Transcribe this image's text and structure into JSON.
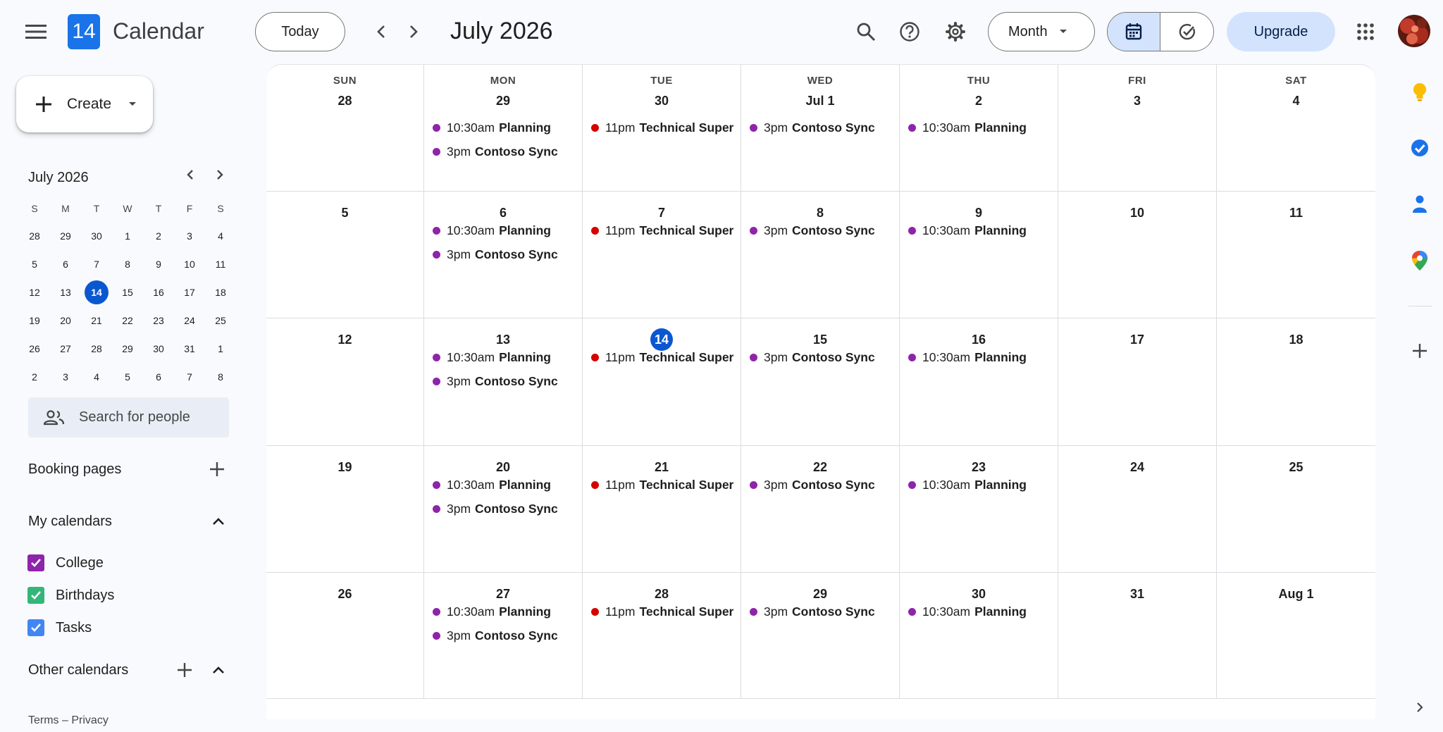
{
  "header": {
    "app_title": "Calendar",
    "logo_date": "14",
    "today_label": "Today",
    "month_title": "July 2026",
    "view_label": "Month",
    "upgrade_label": "Upgrade"
  },
  "sidebar": {
    "create_label": "Create",
    "mini_calendar": {
      "title": "July 2026",
      "weekdays": [
        "S",
        "M",
        "T",
        "W",
        "T",
        "F",
        "S"
      ],
      "weeks": [
        [
          "28",
          "29",
          "30",
          "1",
          "2",
          "3",
          "4"
        ],
        [
          "5",
          "6",
          "7",
          "8",
          "9",
          "10",
          "11"
        ],
        [
          "12",
          "13",
          "14",
          "15",
          "16",
          "17",
          "18"
        ],
        [
          "19",
          "20",
          "21",
          "22",
          "23",
          "24",
          "25"
        ],
        [
          "26",
          "27",
          "28",
          "29",
          "30",
          "31",
          "1"
        ],
        [
          "2",
          "3",
          "4",
          "5",
          "6",
          "7",
          "8"
        ]
      ],
      "today": "14"
    },
    "search_placeholder": "Search for people",
    "booking_pages_label": "Booking pages",
    "my_calendars_label": "My calendars",
    "my_calendars": [
      {
        "label": "College",
        "color": "#8e24aa"
      },
      {
        "label": "Birthdays",
        "color": "#33b679"
      },
      {
        "label": "Tasks",
        "color": "#4285f4"
      }
    ],
    "other_calendars_label": "Other calendars",
    "footer_terms": "Terms",
    "footer_sep": "–",
    "footer_privacy": "Privacy"
  },
  "grid": {
    "weekdays": [
      "SUN",
      "MON",
      "TUE",
      "WED",
      "THU",
      "FRI",
      "SAT"
    ],
    "weeks": [
      [
        "28",
        "29",
        "30",
        "Jul 1",
        "2",
        "3",
        "4"
      ],
      [
        "5",
        "6",
        "7",
        "8",
        "9",
        "10",
        "11"
      ],
      [
        "12",
        "13",
        "14",
        "15",
        "16",
        "17",
        "18"
      ],
      [
        "19",
        "20",
        "21",
        "22",
        "23",
        "24",
        "25"
      ],
      [
        "26",
        "27",
        "28",
        "29",
        "30",
        "31",
        "Aug 1"
      ]
    ],
    "today": {
      "week": 2,
      "day": 2
    },
    "events_by_weekday": {
      "1": [
        {
          "time": "10:30am",
          "title": "Planning",
          "color": "#8e24aa"
        },
        {
          "time": "3pm",
          "title": "Contoso Sync",
          "color": "#8e24aa"
        }
      ],
      "2": [
        {
          "time": "11pm",
          "title": "Technical Superv",
          "color": "#d50000"
        }
      ],
      "3": [
        {
          "time": "3pm",
          "title": "Contoso Sync",
          "color": "#8e24aa"
        }
      ],
      "4": [
        {
          "time": "10:30am",
          "title": "Planning",
          "color": "#8e24aa"
        }
      ]
    }
  },
  "colors": {
    "accent": "#0b57d0",
    "upgrade_bg": "#d3e3fd",
    "view_toggle_active": "#d3e3fd"
  },
  "icons": {
    "menu": "menu-icon",
    "search": "search-icon",
    "help": "help-icon",
    "settings": "gear-icon",
    "apps": "apps-grid-icon",
    "keep": "keep-icon",
    "tasks": "tasks-icon",
    "contacts": "contacts-icon",
    "maps": "maps-icon"
  }
}
